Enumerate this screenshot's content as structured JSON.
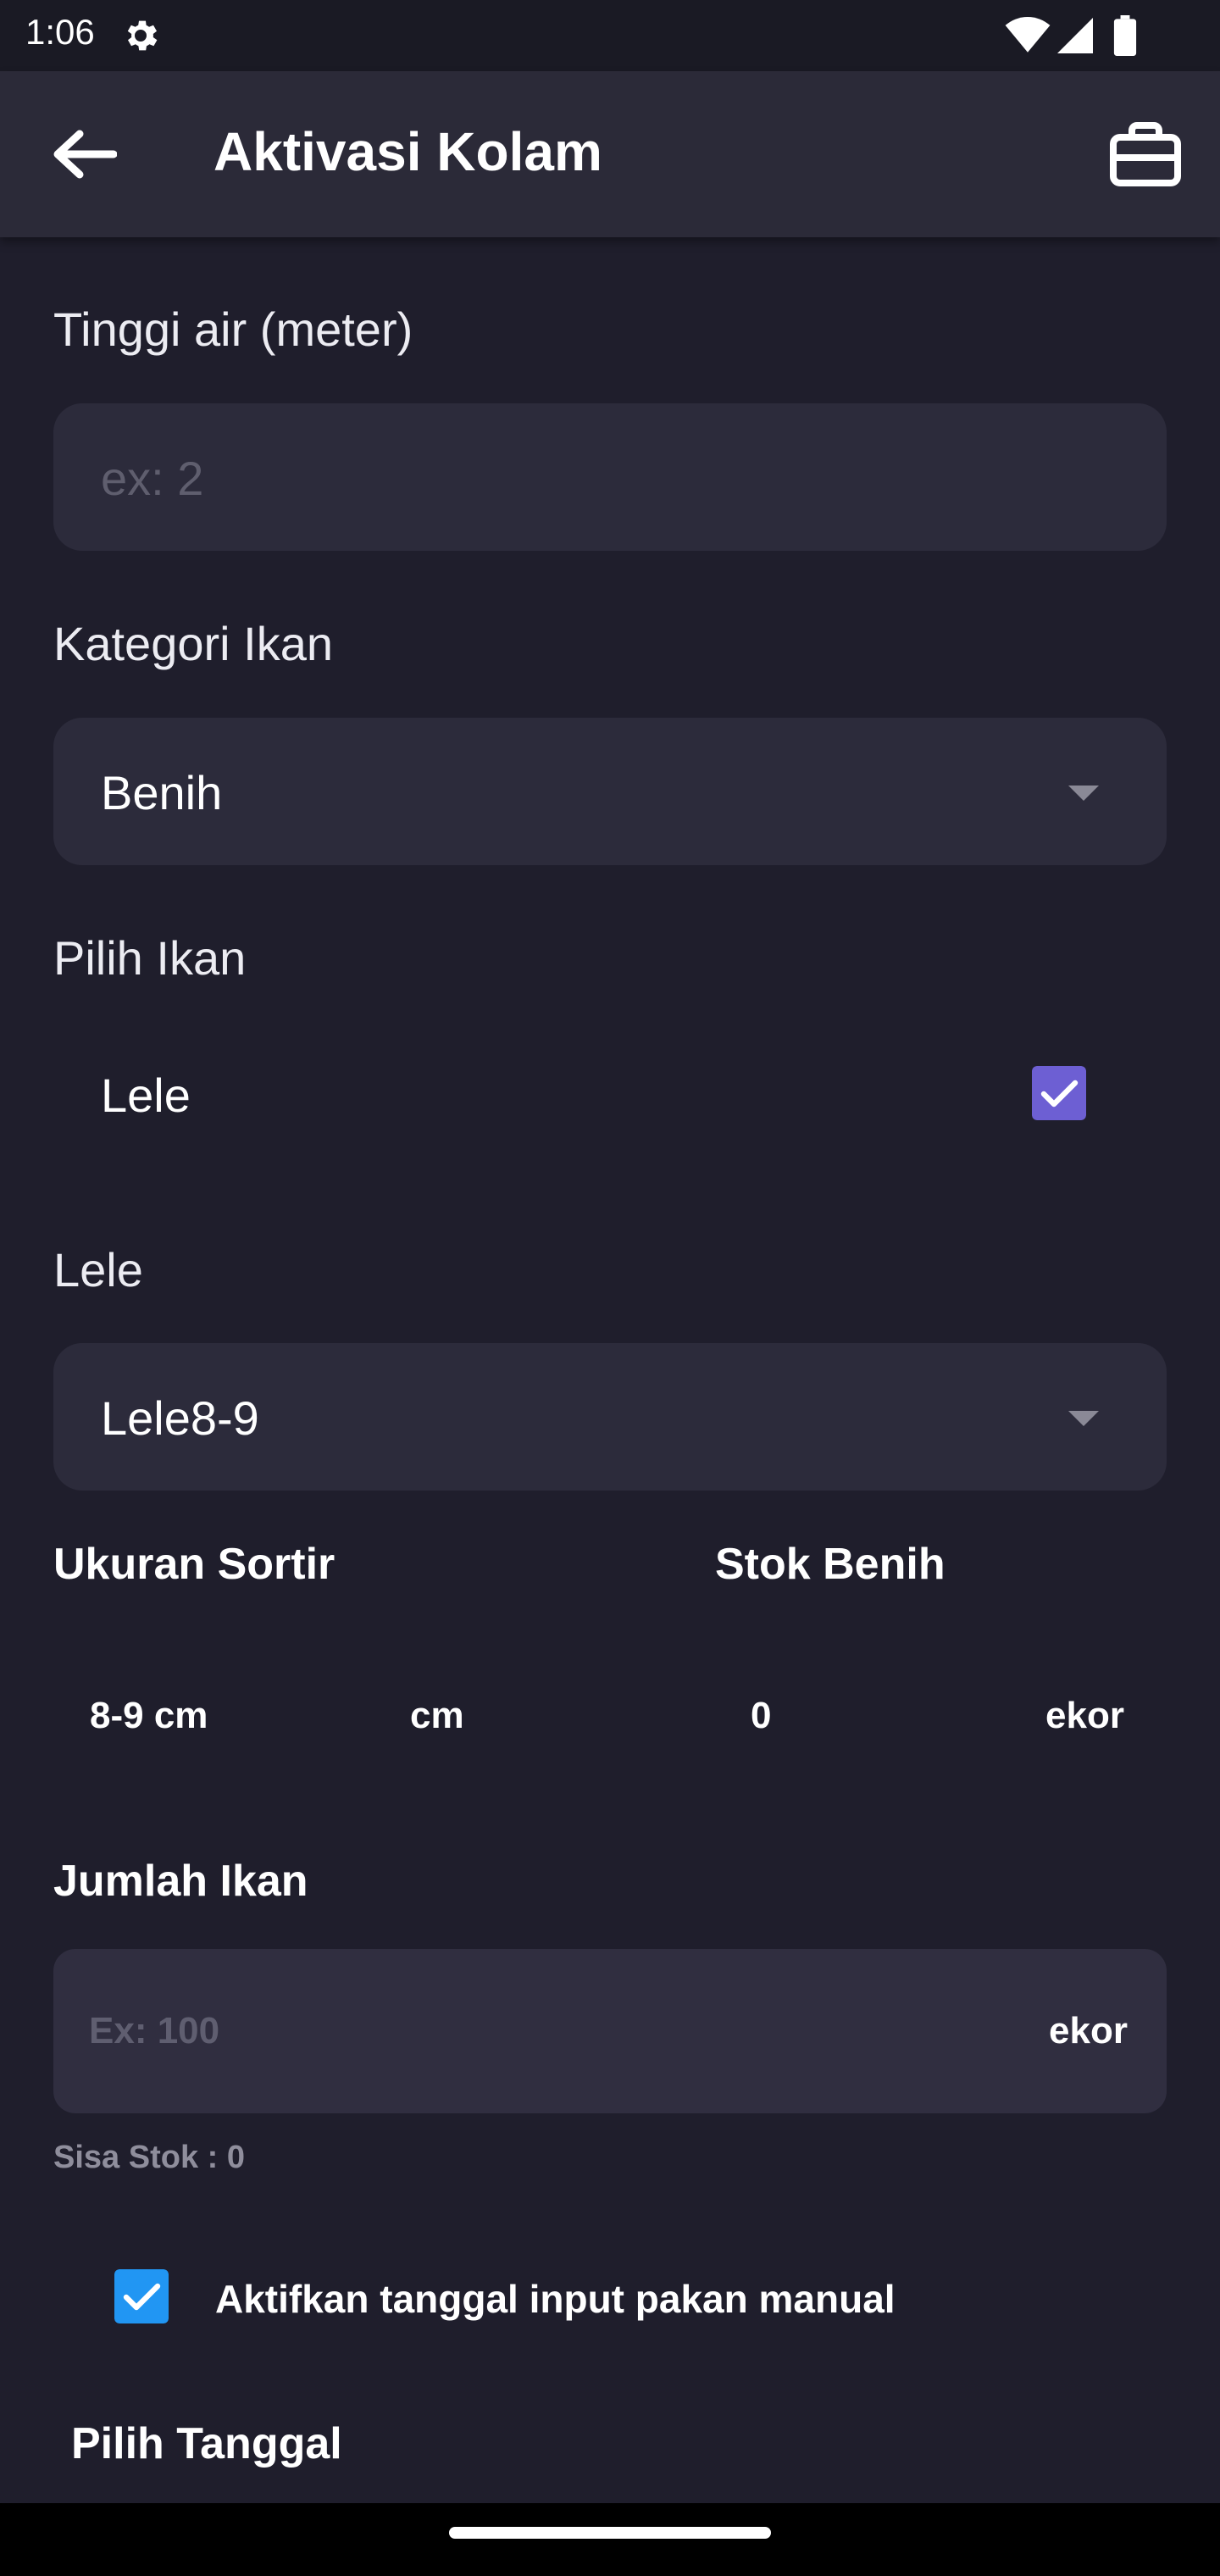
{
  "status_bar": {
    "time": "1:06",
    "icons": [
      "gear-icon",
      "wifi-icon",
      "signal-icon",
      "battery-icon"
    ]
  },
  "app_bar": {
    "title": "Aktivasi Kolam",
    "back_icon": "arrow-left-icon",
    "action_icon": "briefcase-icon"
  },
  "form": {
    "water_height": {
      "label": "Tinggi air (meter)",
      "placeholder": "ex: 2",
      "value": ""
    },
    "fish_category": {
      "label": "Kategori Ikan",
      "selected": "Benih"
    },
    "choose_fish": {
      "label": "Pilih Ikan",
      "options": [
        {
          "label": "Lele",
          "checked": true
        }
      ]
    },
    "lele": {
      "label": "Lele",
      "selected": "Lele8-9"
    },
    "sort_size": {
      "label": "Ukuran Sortir",
      "value": "8-9 cm",
      "unit": "cm"
    },
    "seed_stock": {
      "label": "Stok Benih",
      "value": "0",
      "unit": "ekor"
    },
    "fish_count": {
      "label": "Jumlah Ikan",
      "placeholder": "Ex: 100",
      "unit": "ekor",
      "remaining_stock": "Sisa Stok : 0"
    },
    "manual_feed_date": {
      "label": "Aktifkan tanggal input pakan manual",
      "checked": true
    },
    "choose_date": {
      "label": "Pilih Tanggal"
    }
  },
  "colors": {
    "background": "#1f1e2c",
    "app_bar": "#2b2a38",
    "field": "#2c2b3b",
    "checkbox_fish": "#6d5fd3",
    "checkbox_manual": "#2196f3"
  }
}
